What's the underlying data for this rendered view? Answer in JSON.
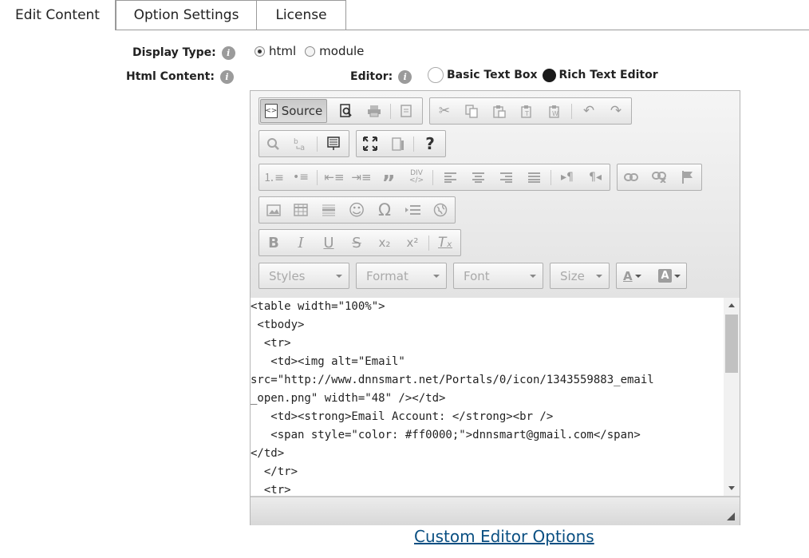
{
  "tabs": [
    {
      "label": "Edit Content",
      "active": true
    },
    {
      "label": "Option Settings",
      "active": false
    },
    {
      "label": "License",
      "active": false
    }
  ],
  "form": {
    "display_type_label": "Display Type:",
    "display_type_options": [
      "html",
      "module"
    ],
    "display_type_selected": "html",
    "html_content_label": "Html Content:",
    "editor_label": "Editor:",
    "editor_options": [
      "Basic Text Box",
      "Rich Text Editor"
    ],
    "editor_selected": "Rich Text Editor",
    "info_glyph": "i"
  },
  "toolbar": {
    "source_label": "Source",
    "styles_placeholder": "Styles",
    "format_placeholder": "Format",
    "font_placeholder": "Font",
    "size_placeholder": "Size"
  },
  "source_code": {
    "lines": [
      "<table width=\"100%\">",
      " <tbody>",
      "  <tr>",
      "   <td><img alt=\"Email\"",
      "src=\"http://www.dnnsmart.net/Portals/0/icon/1343559883_email",
      "_open.png\" width=\"48\" /></td>",
      "   <td><strong>Email Account: </strong><br />",
      "   <span style=\"color: #ff0000;\">dnnsmart@gmail.com</span>",
      "</td>",
      "  </tr>",
      "  <tr>"
    ]
  },
  "links": {
    "custom_editor_options": "Custom Editor Options"
  }
}
